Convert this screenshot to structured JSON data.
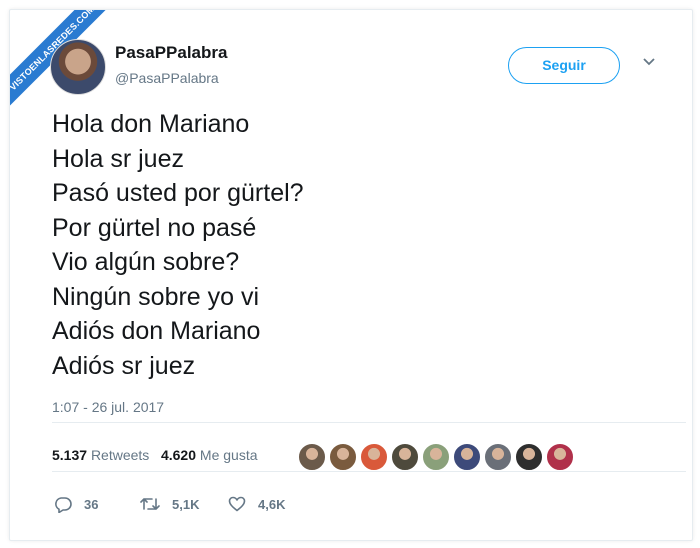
{
  "watermark": {
    "text": "VISTOENLASREDES.COM",
    "color": "#2a7bd1"
  },
  "author": {
    "name": "PasaPPalabra",
    "handle": "@PasaPPalabra"
  },
  "follow_button": {
    "label": "Seguir",
    "color": "#1da1f2"
  },
  "tweet": {
    "lines": [
      "Hola don Mariano",
      "Hola sr juez",
      "Pasó usted por gürtel?",
      "Por gürtel no pasé",
      "Vio algún sobre?",
      "Ningún sobre yo vi",
      "Adiós don Mariano",
      "Adiós sr juez"
    ],
    "timestamp": "1:07 - 26 jul. 2017"
  },
  "stats": {
    "retweets_count": "5.137",
    "retweets_label": "Retweets",
    "likes_count": "4.620",
    "likes_label": "Me gusta"
  },
  "likers": [
    {
      "color": "#6b5a4a"
    },
    {
      "color": "#7a5b3e"
    },
    {
      "color": "#d9593a"
    },
    {
      "color": "#4e4a3c"
    },
    {
      "color": "#8aa07a"
    },
    {
      "color": "#3d4a7a"
    },
    {
      "color": "#6a6f78"
    },
    {
      "color": "#2e2e2e"
    },
    {
      "color": "#b0304a"
    }
  ],
  "actions": {
    "reply_count": "36",
    "retweet_count": "5,1K",
    "like_count": "4,6K",
    "reply_icon": "reply-icon",
    "retweet_icon": "retweet-icon",
    "like_icon": "heart-icon"
  }
}
